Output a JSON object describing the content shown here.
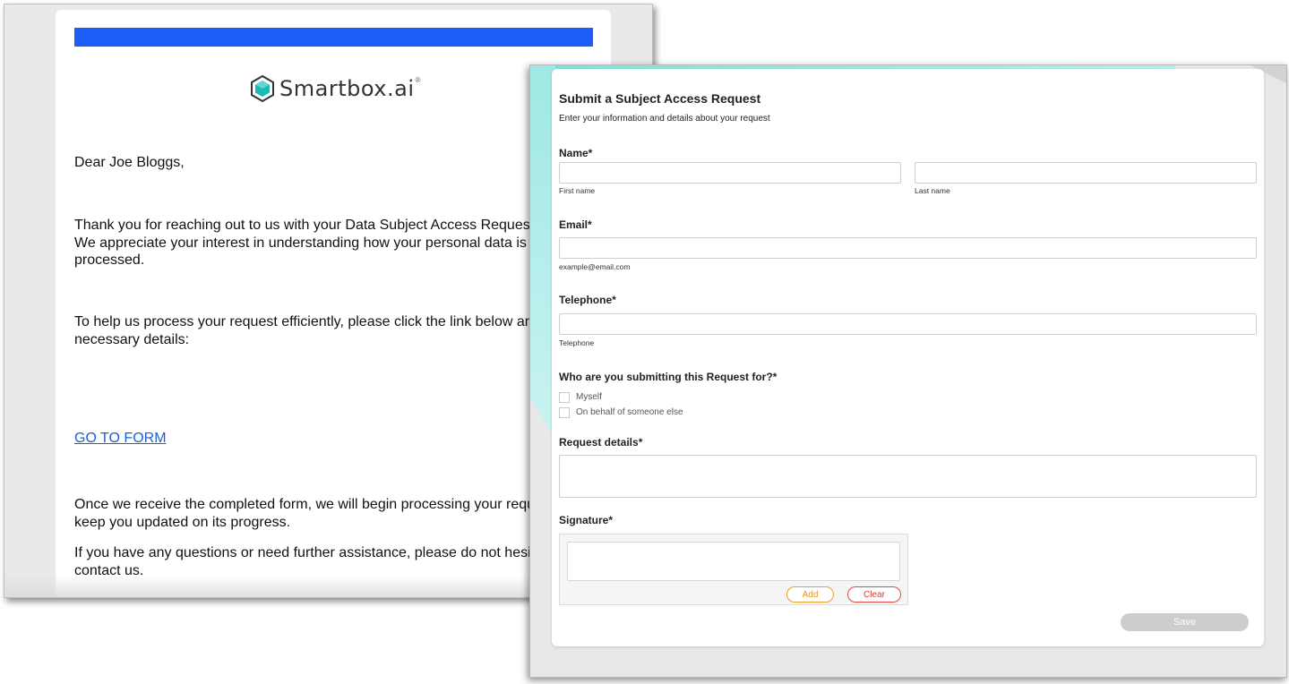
{
  "email": {
    "logo_text": "Smartbox.ai",
    "logo_mark": "®",
    "greeting": "Dear Joe Bloggs,",
    "para1": "Thank you for reaching out to us with your Data Subject Access Request (DSAR). We appreciate your interest in understanding how your personal data is being processed.",
    "para2": "To help us process your request efficiently, please click the link below and fill out the necessary details:",
    "link_label": "GO TO FORM",
    "para3": "Once we receive the completed form, we will begin processing your request and keep you updated on its progress.",
    "para4": "If you have any questions or need further assistance, please do not hesitate to contact us."
  },
  "form": {
    "title": "Submit a Subject Access Request",
    "subtitle": "Enter your information and details about your request",
    "name_label": "Name*",
    "first_name_hint": "First name",
    "last_name_hint": "Last name",
    "email_label": "Email*",
    "email_hint": "example@email.com",
    "telephone_label": "Telephone*",
    "telephone_hint": "Telephone",
    "who_label": "Who are you submitting this Request for?*",
    "options": [
      "Myself",
      "On behalf of someone else"
    ],
    "details_label": "Request details*",
    "signature_label": "Signature*",
    "add_label": "Add",
    "clear_label": "Clear",
    "save_label": "Save"
  },
  "colors": {
    "brand_bar": "#1e5cf6",
    "link": "#1a5fd6",
    "teal_accent": "#9fe8e4",
    "add_button": "#e8a030",
    "clear_button": "#e24b4b",
    "save_disabled": "#cdcdcd"
  }
}
